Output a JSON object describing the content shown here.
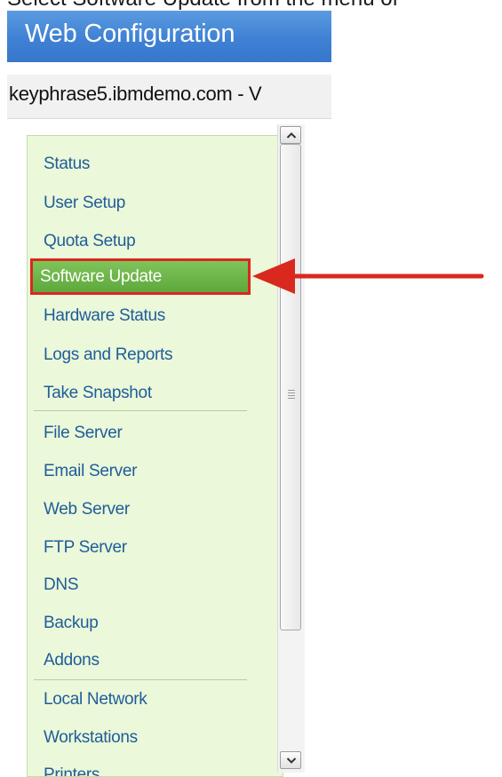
{
  "caption": "Select Software Update from the menu of",
  "window": {
    "title": "Web Configuration",
    "host": "keyphrase5.ibmdemo.com - V"
  },
  "nav": {
    "group1": [
      "Status",
      "User Setup",
      "Quota Setup"
    ],
    "selected": "Software Update",
    "group1b": [
      "Hardware Status",
      "Logs and Reports",
      "Take Snapshot"
    ],
    "group2": [
      "File Server",
      "Email Server",
      "Web Server",
      "FTP Server",
      "DNS",
      "Backup",
      "Addons"
    ],
    "group3": [
      "Local Network",
      "Workstations",
      "Printers"
    ]
  },
  "colors": {
    "title_bar": "#3f81d4",
    "nav_background": "#ebf8d9",
    "nav_link": "#1f5d9a",
    "selected_background": "#5ea83c",
    "highlight": "#d9281e"
  },
  "icons": {
    "scroll_up": "chevron-up-icon",
    "scroll_down": "chevron-down-icon",
    "scroll_grip": "grip-icon",
    "annotation": "arrow-left-icon"
  }
}
